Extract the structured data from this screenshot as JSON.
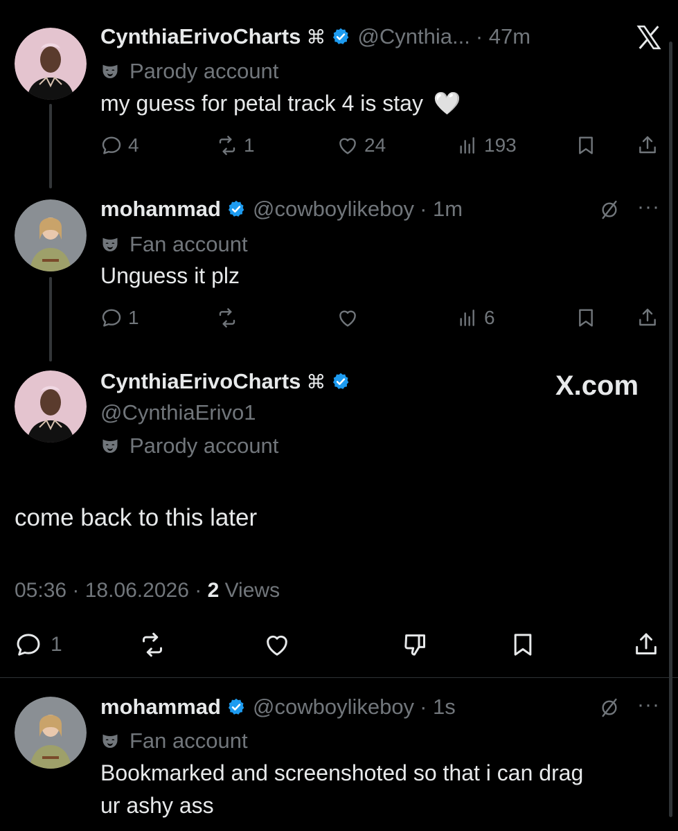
{
  "thread": {
    "tweet1": {
      "name": "CynthiaErivoCharts",
      "glyph": "⌘",
      "handle": "@Cynthia...",
      "time": "· 47m",
      "label": "Parody account",
      "text": "my guess for petal track 4 is stay",
      "emoji": "🤍",
      "replies": "4",
      "reposts": "1",
      "likes": "24",
      "views": "193",
      "close_icon": "x-logo-icon"
    },
    "tweet2": {
      "name": "mohammad",
      "handle": "@cowboylikeboy",
      "time": "· 1m",
      "label": "Fan account",
      "text": "Unguess it plz",
      "replies": "1",
      "views": "6"
    }
  },
  "main_tweet": {
    "name": "CynthiaErivoCharts",
    "glyph": "⌘",
    "handle": "@CynthiaErivo1",
    "label": "Parody account",
    "watermark": "X.com",
    "text": "come back to this later",
    "meta_time": "05:36 · 18.06.2026 ·",
    "meta_views_count": "2",
    "meta_views_label": "Views",
    "replies": "1"
  },
  "reply": {
    "name": "mohammad",
    "handle": "@cowboylikeboy",
    "time": "· 1s",
    "label": "Fan account",
    "text_line1": "Bookmarked and screenshoted so that i can drag",
    "text_line2": "ur ashy ass"
  },
  "colors": {
    "background": "#000000",
    "text": "#e7e9ea",
    "muted": "#71767b",
    "verified": "#1d9bf0"
  }
}
